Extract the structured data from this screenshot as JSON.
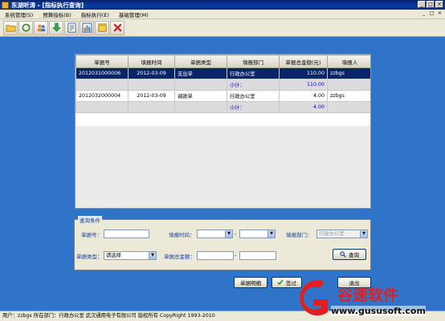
{
  "window": {
    "title": "东湖听涛 - [指标执行查询]"
  },
  "menu": [
    "系统管理(S)",
    "预算指标(B)",
    "指标执行(E)",
    "基础管理(M)"
  ],
  "toolbar": [
    "folder-open-icon",
    "refresh-icon",
    "users-icon",
    "download-icon",
    "report-icon",
    "chart-icon",
    "document-icon",
    "close-red-icon"
  ],
  "grid": {
    "columns": [
      "单据号",
      "填报时间",
      "单据类型",
      "填报部门",
      "单据总金额(元)",
      "填报人"
    ],
    "rows": [
      {
        "cells": [
          "2012031000006",
          "2012-03-09",
          "支出单",
          "行政办公室",
          "110.00",
          "zzbgs"
        ],
        "selected": true
      },
      {
        "cells": [
          "",
          "",
          "",
          "小计：",
          "110.00",
          ""
        ],
        "subtotal": true
      },
      {
        "cells": [
          "2012032000004",
          "2012-03-09",
          "调款单",
          "行政办公室",
          "4.00",
          "zzbgs"
        ]
      },
      {
        "cells": [
          "",
          "",
          "",
          "小计：",
          "4.00",
          ""
        ],
        "subtotal": true
      }
    ]
  },
  "query": {
    "legend": "查询条件",
    "doc_no_label": "单据号：",
    "fill_time_label": "填报时间：",
    "dept_label": "填报部门：",
    "dept_value": "行政办公室",
    "doc_type_label": "单据类型：",
    "doc_type_value": "请选择",
    "amount_label": "单据总金额：",
    "search_label": "查询"
  },
  "buttons": {
    "detail": "单据明细",
    "other": "签过",
    "exit": "退出"
  },
  "status": "用户：zzbgs 所在部门：行政办公室 武汉通用电子有限公司 版权所有 CopyRight 1993-2010",
  "watermark": {
    "brand": "谷速软件",
    "url": "www.gususoft.com"
  }
}
